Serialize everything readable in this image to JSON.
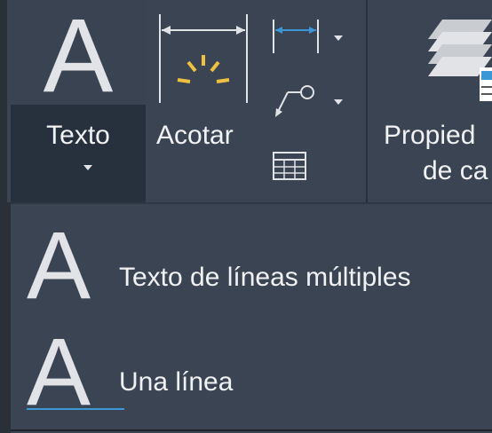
{
  "ribbon": {
    "texto_button": {
      "glyph": "A",
      "label": "Texto"
    },
    "acotar_button": {
      "label": "Acotar"
    },
    "propiedades_button": {
      "label_line1": "Propied",
      "label_line2": "de ca"
    }
  },
  "dropdown": {
    "items": [
      {
        "glyph": "A",
        "label": "Texto de líneas múltiples"
      },
      {
        "glyph": "A",
        "label": "Una línea"
      }
    ]
  },
  "colors": {
    "accent_blue": "#3c97d6",
    "accent_yellow": "#f0c040",
    "panel": "#3b4453",
    "text": "#f1f2f4"
  }
}
